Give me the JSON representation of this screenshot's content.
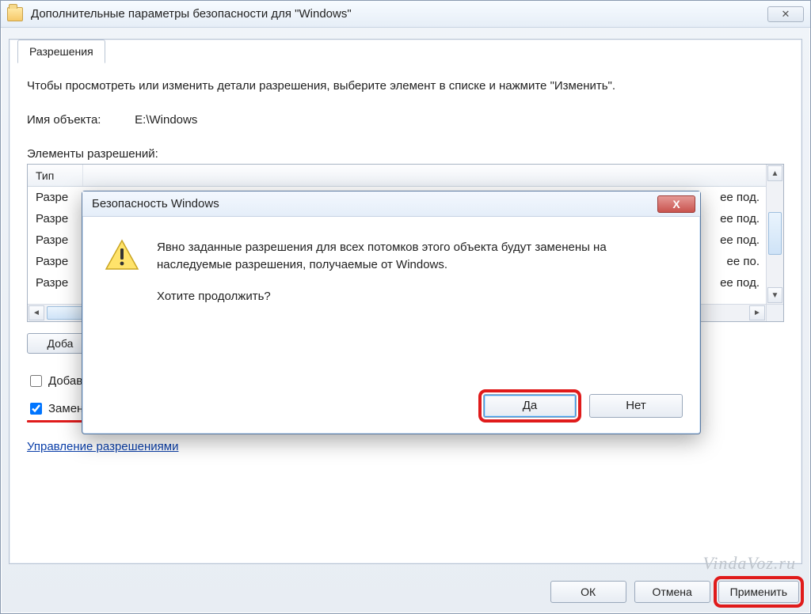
{
  "window": {
    "title": "Дополнительные параметры безопасности  для \"Windows\"",
    "close_glyph": "✕"
  },
  "tab": {
    "label": "Разрешения"
  },
  "instruction": "Чтобы просмотреть или изменить детали разрешения, выберите элемент в списке и нажмите \"Изменить\".",
  "object": {
    "label": "Имя объекта:",
    "value": "E:\\Windows"
  },
  "perm_label": "Элементы разрешений:",
  "columns": {
    "type": "Тип"
  },
  "rows": [
    {
      "c1": "Разре",
      "c2": "ее под."
    },
    {
      "c1": "Разре",
      "c2": "ее под."
    },
    {
      "c1": "Разре",
      "c2": "ее под."
    },
    {
      "c1": "Разре",
      "c2": "ее по."
    },
    {
      "c1": "Разре",
      "c2": "ее под."
    }
  ],
  "buttons": {
    "add": "Доба",
    "ok": "ОК",
    "cancel": "Отмена",
    "apply": "Применить"
  },
  "check_inherit": "Добавить разрешения, наследуемые от родительских объектов",
  "check_replace": "Заменить все разрешения дочернего объекта на разрешения, наследуемые от этого объекта",
  "link": "Управление разрешениями",
  "dialog": {
    "title": "Безопасность Windows",
    "line1": "Явно заданные разрешения для всех потомков этого объекта будут заменены на наследуемые разрешения, получаемые от Windows.",
    "line2": "Хотите продолжить?",
    "yes": "Да",
    "no": "Нет",
    "close_glyph": "X"
  },
  "watermark": "VindaVoz.ru"
}
